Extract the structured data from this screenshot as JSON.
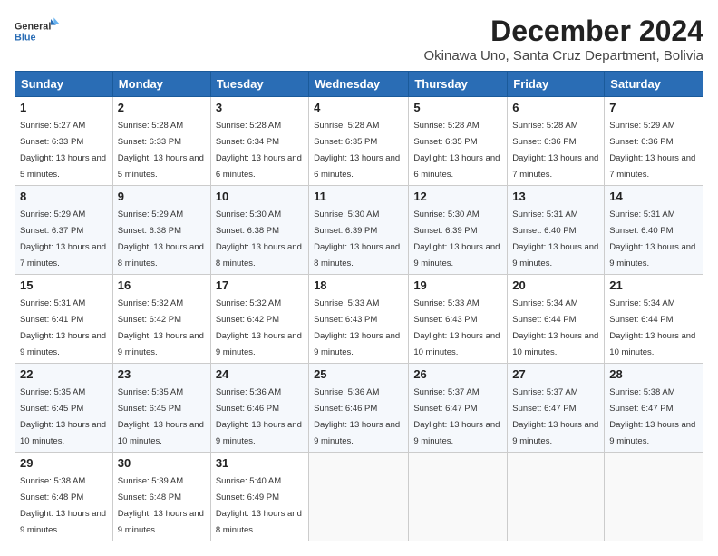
{
  "logo": {
    "line1": "General",
    "line2": "Blue"
  },
  "title": "December 2024",
  "subtitle": "Okinawa Uno, Santa Cruz Department, Bolivia",
  "days_of_week": [
    "Sunday",
    "Monday",
    "Tuesday",
    "Wednesday",
    "Thursday",
    "Friday",
    "Saturday"
  ],
  "weeks": [
    [
      {
        "day": "1",
        "sunrise": "5:27 AM",
        "sunset": "6:33 PM",
        "daylight": "13 hours and 5 minutes."
      },
      {
        "day": "2",
        "sunrise": "5:28 AM",
        "sunset": "6:33 PM",
        "daylight": "13 hours and 5 minutes."
      },
      {
        "day": "3",
        "sunrise": "5:28 AM",
        "sunset": "6:34 PM",
        "daylight": "13 hours and 6 minutes."
      },
      {
        "day": "4",
        "sunrise": "5:28 AM",
        "sunset": "6:35 PM",
        "daylight": "13 hours and 6 minutes."
      },
      {
        "day": "5",
        "sunrise": "5:28 AM",
        "sunset": "6:35 PM",
        "daylight": "13 hours and 6 minutes."
      },
      {
        "day": "6",
        "sunrise": "5:28 AM",
        "sunset": "6:36 PM",
        "daylight": "13 hours and 7 minutes."
      },
      {
        "day": "7",
        "sunrise": "5:29 AM",
        "sunset": "6:36 PM",
        "daylight": "13 hours and 7 minutes."
      }
    ],
    [
      {
        "day": "8",
        "sunrise": "5:29 AM",
        "sunset": "6:37 PM",
        "daylight": "13 hours and 7 minutes."
      },
      {
        "day": "9",
        "sunrise": "5:29 AM",
        "sunset": "6:38 PM",
        "daylight": "13 hours and 8 minutes."
      },
      {
        "day": "10",
        "sunrise": "5:30 AM",
        "sunset": "6:38 PM",
        "daylight": "13 hours and 8 minutes."
      },
      {
        "day": "11",
        "sunrise": "5:30 AM",
        "sunset": "6:39 PM",
        "daylight": "13 hours and 8 minutes."
      },
      {
        "day": "12",
        "sunrise": "5:30 AM",
        "sunset": "6:39 PM",
        "daylight": "13 hours and 9 minutes."
      },
      {
        "day": "13",
        "sunrise": "5:31 AM",
        "sunset": "6:40 PM",
        "daylight": "13 hours and 9 minutes."
      },
      {
        "day": "14",
        "sunrise": "5:31 AM",
        "sunset": "6:40 PM",
        "daylight": "13 hours and 9 minutes."
      }
    ],
    [
      {
        "day": "15",
        "sunrise": "5:31 AM",
        "sunset": "6:41 PM",
        "daylight": "13 hours and 9 minutes."
      },
      {
        "day": "16",
        "sunrise": "5:32 AM",
        "sunset": "6:42 PM",
        "daylight": "13 hours and 9 minutes."
      },
      {
        "day": "17",
        "sunrise": "5:32 AM",
        "sunset": "6:42 PM",
        "daylight": "13 hours and 9 minutes."
      },
      {
        "day": "18",
        "sunrise": "5:33 AM",
        "sunset": "6:43 PM",
        "daylight": "13 hours and 9 minutes."
      },
      {
        "day": "19",
        "sunrise": "5:33 AM",
        "sunset": "6:43 PM",
        "daylight": "13 hours and 10 minutes."
      },
      {
        "day": "20",
        "sunrise": "5:34 AM",
        "sunset": "6:44 PM",
        "daylight": "13 hours and 10 minutes."
      },
      {
        "day": "21",
        "sunrise": "5:34 AM",
        "sunset": "6:44 PM",
        "daylight": "13 hours and 10 minutes."
      }
    ],
    [
      {
        "day": "22",
        "sunrise": "5:35 AM",
        "sunset": "6:45 PM",
        "daylight": "13 hours and 10 minutes."
      },
      {
        "day": "23",
        "sunrise": "5:35 AM",
        "sunset": "6:45 PM",
        "daylight": "13 hours and 10 minutes."
      },
      {
        "day": "24",
        "sunrise": "5:36 AM",
        "sunset": "6:46 PM",
        "daylight": "13 hours and 9 minutes."
      },
      {
        "day": "25",
        "sunrise": "5:36 AM",
        "sunset": "6:46 PM",
        "daylight": "13 hours and 9 minutes."
      },
      {
        "day": "26",
        "sunrise": "5:37 AM",
        "sunset": "6:47 PM",
        "daylight": "13 hours and 9 minutes."
      },
      {
        "day": "27",
        "sunrise": "5:37 AM",
        "sunset": "6:47 PM",
        "daylight": "13 hours and 9 minutes."
      },
      {
        "day": "28",
        "sunrise": "5:38 AM",
        "sunset": "6:47 PM",
        "daylight": "13 hours and 9 minutes."
      }
    ],
    [
      {
        "day": "29",
        "sunrise": "5:38 AM",
        "sunset": "6:48 PM",
        "daylight": "13 hours and 9 minutes."
      },
      {
        "day": "30",
        "sunrise": "5:39 AM",
        "sunset": "6:48 PM",
        "daylight": "13 hours and 9 minutes."
      },
      {
        "day": "31",
        "sunrise": "5:40 AM",
        "sunset": "6:49 PM",
        "daylight": "13 hours and 8 minutes."
      },
      null,
      null,
      null,
      null
    ]
  ]
}
